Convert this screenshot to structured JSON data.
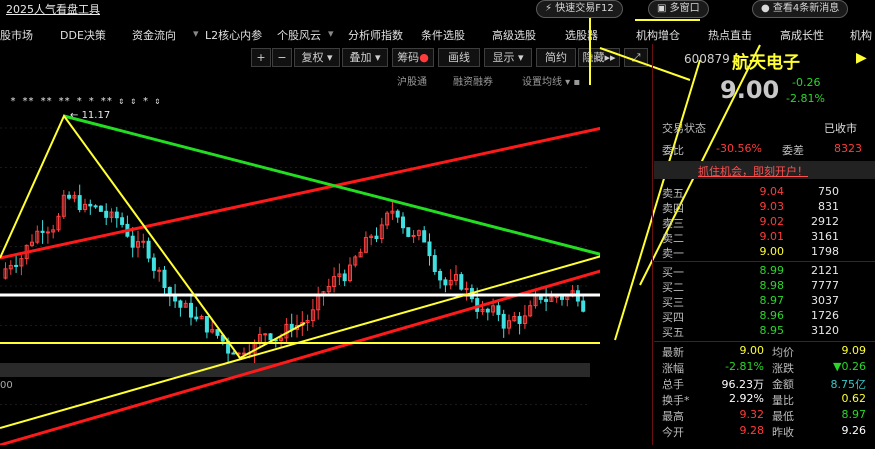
{
  "app": {
    "title": "2025人气看盘工具"
  },
  "top_buttons": {
    "quick_trade": "快速交易F12",
    "multi_window": "多窗口",
    "messages": "查看4条新消息"
  },
  "menu": [
    "股市场",
    "DDE决策",
    "资金流向",
    "L2核心内参",
    "个股风云",
    "分析师指数",
    "条件选股",
    "高级选股",
    "选股器",
    "机构增仓",
    "热点直击",
    "高成长性",
    "机构"
  ],
  "toolbar": {
    "plus": "+",
    "minus": "−",
    "restore": "复权",
    "overlay": "叠加",
    "chips": "筹码",
    "draw": "画线",
    "display": "显示",
    "simple": "简约",
    "hide": "隐藏"
  },
  "subbar": {
    "hgt": "沪股通",
    "margin": "融资融券",
    "ma": "设置均线"
  },
  "chart": {
    "y_ticks": [
      "11.00",
      "10.50",
      "10.00",
      "9.50",
      "9.00",
      "8.50",
      "8.00",
      "7.50"
    ],
    "high_label": "11.17",
    "bottom_left": "00",
    "star_marks": "*  ** **      ** *   *    **       ⇕ ⇕              *        ⇕",
    "colors": {
      "up": "#ff4040",
      "down": "#40e0e0",
      "red_line": "#ff1a1a",
      "green_line": "#22dd22",
      "yellow_line": "#ffff33"
    }
  },
  "quote": {
    "code": "600879",
    "name": "航天电子",
    "price": "9.00",
    "change": "-0.26",
    "change_pct": "-2.81%",
    "status_label": "交易状态",
    "status": "已收市",
    "wei_bi_label": "委比",
    "wei_bi": "-30.56%",
    "wei_cha_label": "委差",
    "wei_cha": "8323",
    "banner": "抓住机会，即刻开户！",
    "asks": [
      {
        "label": "卖五",
        "price": "9.04",
        "vol": "750"
      },
      {
        "label": "卖四",
        "price": "9.03",
        "vol": "831"
      },
      {
        "label": "卖三",
        "price": "9.02",
        "vol": "2912"
      },
      {
        "label": "卖二",
        "price": "9.01",
        "vol": "3161"
      },
      {
        "label": "卖一",
        "price": "9.00",
        "vol": "1798"
      }
    ],
    "bids": [
      {
        "label": "买一",
        "price": "8.99",
        "vol": "2121"
      },
      {
        "label": "买二",
        "price": "8.98",
        "vol": "7777"
      },
      {
        "label": "买三",
        "price": "8.97",
        "vol": "3037"
      },
      {
        "label": "买四",
        "price": "8.96",
        "vol": "1726"
      },
      {
        "label": "买五",
        "price": "8.95",
        "vol": "3120"
      }
    ],
    "stats": [
      {
        "k1": "最新",
        "v1": "9.00",
        "c1": "yellow",
        "k2": "均价",
        "v2": "9.09",
        "c2": "yellow"
      },
      {
        "k1": "涨幅",
        "v1": "-2.81%",
        "c1": "green",
        "k2": "涨跌",
        "v2": "▼0.26",
        "c2": "green"
      },
      {
        "k1": "总手",
        "v1": "96.23万",
        "c1": "white",
        "k2": "金额",
        "v2": "8.75亿",
        "c2": "cyan"
      },
      {
        "k1": "换手*",
        "v1": "2.92%",
        "c1": "white",
        "k2": "量比",
        "v2": "0.62",
        "c2": "yellow"
      },
      {
        "k1": "最高",
        "v1": "9.32",
        "c1": "red",
        "k2": "最低",
        "v2": "8.97",
        "c2": "green"
      },
      {
        "k1": "今开",
        "v1": "9.28",
        "c1": "red",
        "k2": "昨收",
        "v2": "9.26",
        "c2": "white"
      }
    ]
  }
}
